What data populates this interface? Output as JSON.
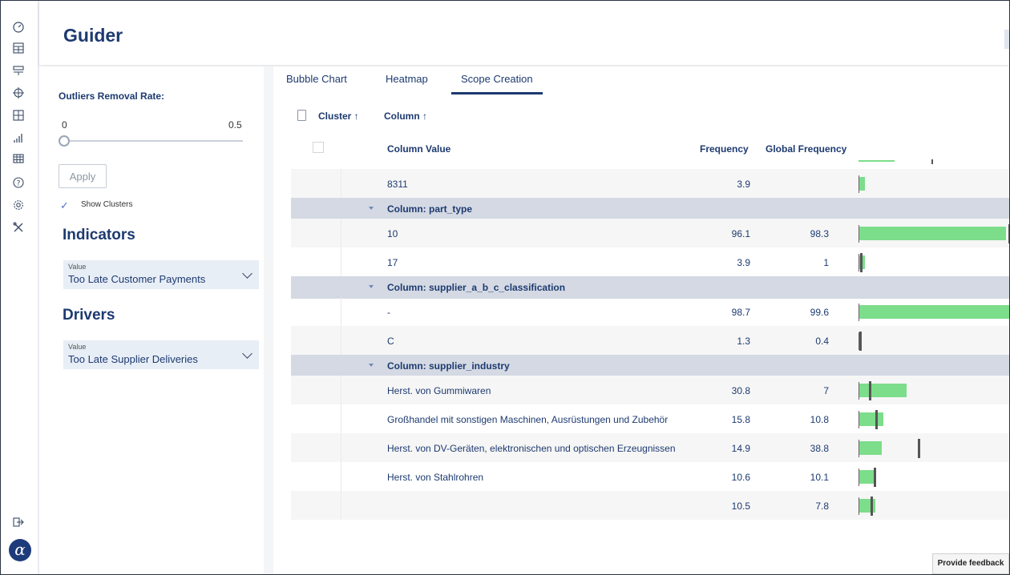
{
  "app": {
    "title": "Guider"
  },
  "rail": {
    "icons": [
      "gauge-icon",
      "dashboard-icon",
      "stack-icon",
      "target-icon",
      "grid-icon",
      "bar-chart-icon",
      "table-icon",
      "help-icon",
      "settings-icon",
      "tools-icon",
      "logout-icon",
      "alpha-logo"
    ],
    "logo_letter": "α"
  },
  "panel": {
    "outliers_label": "Outliers Removal Rate:",
    "slider_min": "0",
    "slider_max": "0.5",
    "slider_value": 0,
    "apply_label": "Apply",
    "show_clusters_label": "Show Clusters",
    "show_clusters_checked": true,
    "indicators_heading": "Indicators",
    "indicators_dropdown": {
      "label": "Value",
      "value": "Too Late Customer Payments"
    },
    "drivers_heading": "Drivers",
    "drivers_dropdown": {
      "label": "Value",
      "value": "Too Late Supplier Deliveries"
    }
  },
  "main": {
    "tabs": [
      {
        "label": "Bubble Chart"
      },
      {
        "label": "Heatmap"
      },
      {
        "label": "Scope Creation",
        "active": true
      }
    ],
    "sort": {
      "cluster": "Cluster ↑",
      "column": "Column ↑"
    },
    "headers": {
      "value": "Column Value",
      "freq": "Frequency",
      "gfreq": "Global Frequency"
    },
    "rows": [
      {
        "type": "data",
        "value": "8311",
        "freq": "3.9",
        "gfreq": ""
      },
      {
        "type": "group",
        "value": "Column: part_type"
      },
      {
        "type": "data",
        "value": "10",
        "freq": "96.1",
        "gfreq": "98.3"
      },
      {
        "type": "data",
        "value": "17",
        "freq": "3.9",
        "gfreq": "1"
      },
      {
        "type": "group",
        "value": "Column: supplier_a_b_c_classification"
      },
      {
        "type": "data",
        "value": "-",
        "freq": "98.7",
        "gfreq": "99.6"
      },
      {
        "type": "data",
        "value": "C",
        "freq": "1.3",
        "gfreq": "0.4"
      },
      {
        "type": "group",
        "value": "Column: supplier_industry"
      },
      {
        "type": "data",
        "value": "Herst. von Gummiwaren",
        "freq": "30.8",
        "gfreq": "7"
      },
      {
        "type": "data",
        "value": "Großhandel mit sonstigen Maschinen, Ausrüstungen und Zubehör",
        "freq": "15.8",
        "gfreq": "10.8"
      },
      {
        "type": "data",
        "value": "Herst. von DV-Geräten, elektronischen und optischen Erzeugnissen",
        "freq": "14.9",
        "gfreq": "38.8"
      },
      {
        "type": "data",
        "value": "Herst. von Stahlrohren",
        "freq": "10.6",
        "gfreq": "10.1"
      },
      {
        "type": "data",
        "value": "",
        "freq": "10.5",
        "gfreq": "7.8"
      }
    ],
    "feedback_label": "Provide feedback"
  },
  "colors": {
    "brand": "#1d3a70",
    "bar": "#7cdd8a",
    "group_row": "#d4d9e3"
  }
}
